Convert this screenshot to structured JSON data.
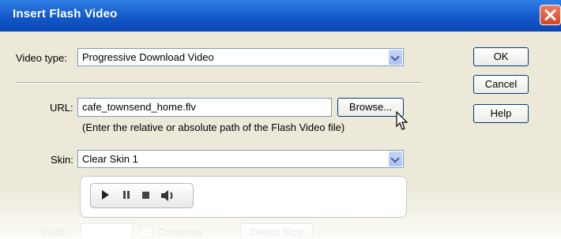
{
  "window": {
    "title": "Insert Flash Video"
  },
  "video_type": {
    "label": "Video type:",
    "value": "Progressive Download Video"
  },
  "url": {
    "label": "URL:",
    "value": "cafe_townsend_home.flv",
    "browse_label": "Browse...",
    "hint": "(Enter the relative or absolute path of the Flash Video file)"
  },
  "skin": {
    "label": "Skin:",
    "value": "Clear Skin 1"
  },
  "size": {
    "width_label": "Width:",
    "constrain_label": "Constrain",
    "detect_label": "Detect Size"
  },
  "buttons": {
    "ok": "OK",
    "cancel": "Cancel",
    "help": "Help"
  },
  "icons": [
    "close-icon",
    "chevron-down-icon",
    "play-icon",
    "pause-icon",
    "stop-icon",
    "volume-icon",
    "mouse-cursor-icon"
  ]
}
